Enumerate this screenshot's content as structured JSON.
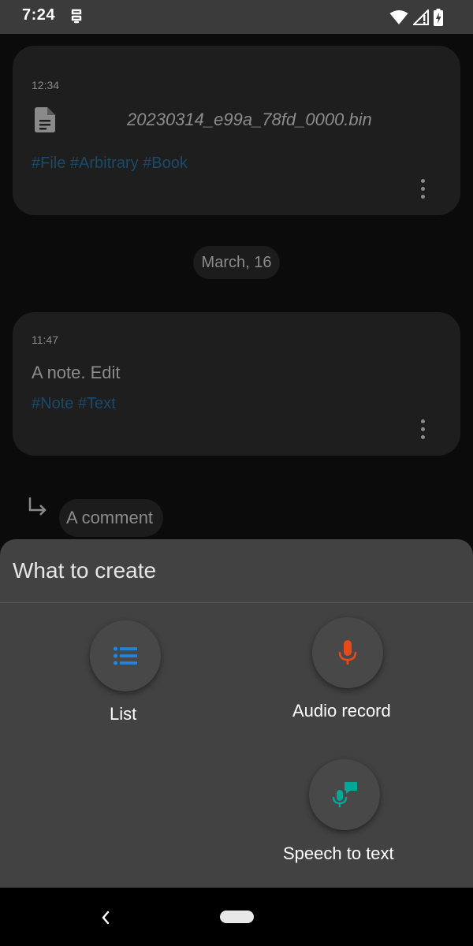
{
  "status_bar": {
    "time": "7:24",
    "icons": [
      "app-notification-icon",
      "wifi-icon",
      "cellular-signal-icon",
      "battery-charging-icon"
    ]
  },
  "cards": [
    {
      "time": "12:34",
      "file_icon": "document-icon",
      "filename": "20230314_e99a_78fd_0000.bin",
      "tags": "#File #Arbitrary #Book",
      "menu_icon": "more-vert-icon"
    },
    {
      "time": "11:47",
      "text": "A note. Edit",
      "tags": "#Note #Text",
      "menu_icon": "more-vert-icon"
    }
  ],
  "date_separator": "March, 16",
  "comment": {
    "icon": "reply-arrow-icon",
    "text": "A comment"
  },
  "sheet": {
    "title": "What to create",
    "options": [
      {
        "label": "List",
        "icon": "list-icon",
        "color": "#1e88e5"
      },
      {
        "label": "Audio record",
        "icon": "microphone-icon",
        "color": "#e64a19"
      },
      {
        "label": "Speech to text",
        "icon": "speech-to-text-icon",
        "color": "#00a896"
      }
    ]
  },
  "nav_bar": {
    "icons": [
      "back-icon",
      "home-pill-icon"
    ]
  },
  "colors": {
    "sheet_background": "#424242",
    "tag_color": "#1a4a6a",
    "list_accent": "#1e88e5",
    "audio_accent": "#e64a19",
    "speech_accent": "#00a896"
  }
}
